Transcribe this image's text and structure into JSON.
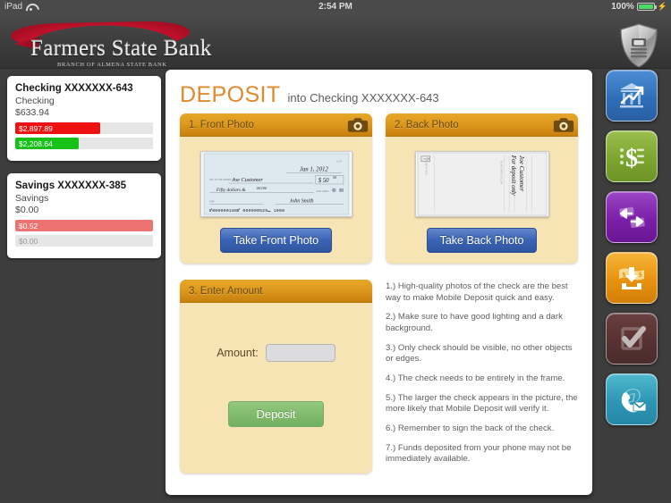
{
  "status_bar": {
    "device": "iPad",
    "wifi_icon": "wifi-icon",
    "time": "2:54 PM",
    "battery_percent": "100%",
    "battery_icon": "battery-full-icon",
    "charging_icon": "lightning-bolt-icon"
  },
  "header": {
    "bank_name": "Farmers State Bank",
    "bank_subtitle": "BRANCH OF ALMENA STATE BANK",
    "security_icon": "shield-lock-icon"
  },
  "accounts": [
    {
      "title": "Checking XXXXXXX-643",
      "type": "Checking",
      "balance": "$633.94",
      "bars": [
        {
          "label": "$2,897.89",
          "color": "#ee1111",
          "pct": 62,
          "style": "solid"
        },
        {
          "label": "$2,208.64",
          "color": "#17c117",
          "pct": 46,
          "style": "solid"
        }
      ]
    },
    {
      "title": "Savings XXXXXXX-385",
      "type": "Savings",
      "balance": "$0.00",
      "bars": [
        {
          "label": "$0.52",
          "color": "#ed7272",
          "pct": 100,
          "style": "solid"
        },
        {
          "label": "$0.00",
          "color": "#e6e6e6",
          "pct": 100,
          "style": "gray"
        }
      ]
    }
  ],
  "main": {
    "title": "DEPOSIT",
    "subtitle": "into Checking XXXXXXX-643",
    "title_color": "#e08a2e",
    "panels": {
      "front": {
        "heading": "1. Front Photo",
        "camera_icon": "camera-icon",
        "button": "Take Front Photo",
        "check_image": {
          "date": "Jan 1, 2012",
          "payee": "Joe Customer",
          "amount_numeric": "50",
          "amount_cents": "00",
          "amount_words": "Fifty dollars & 00/100",
          "signature": "John Smith",
          "micr": "c000000186c  000000529r  1000",
          "memo_label": "MEMO"
        }
      },
      "back": {
        "heading": "2. Back Photo",
        "camera_icon": "camera-icon",
        "button": "Take Back Photo",
        "endorsement": "Joe Customer For deposit only"
      },
      "amount": {
        "heading": "3. Enter Amount",
        "label": "Amount:",
        "input_value": "",
        "input_placeholder": "",
        "button": "Deposit"
      }
    },
    "tips": [
      "1.) High-quality photos of the check are the best way to make Mobile Deposit quick and easy.",
      "2.) Make sure to have good lighting and a dark background.",
      "3.) Only check should be visible, no other objects or edges.",
      "4.) The check needs to be entirely in the frame.",
      "5.) The larger the check appears in the picture, the more likely that Mobile Deposit will verify it.",
      "6.) Remember to sign the back of the check.",
      "7.) Funds deposited from your phone may not be immediately available."
    ]
  },
  "rail": [
    {
      "name": "accounts",
      "icon": "bank-chart-icon",
      "class": "r-blue"
    },
    {
      "name": "bill-pay",
      "icon": "dollar-sign-icon",
      "class": "r-green"
    },
    {
      "name": "transfers",
      "icon": "transfer-arrows-icon",
      "class": "r-purple"
    },
    {
      "name": "deposit",
      "icon": "deposit-download-icon",
      "class": "r-orange"
    },
    {
      "name": "check-approve",
      "icon": "check-mark-icon",
      "class": "r-maroon"
    },
    {
      "name": "contact",
      "icon": "phone-envelope-icon",
      "class": "r-teal"
    }
  ]
}
